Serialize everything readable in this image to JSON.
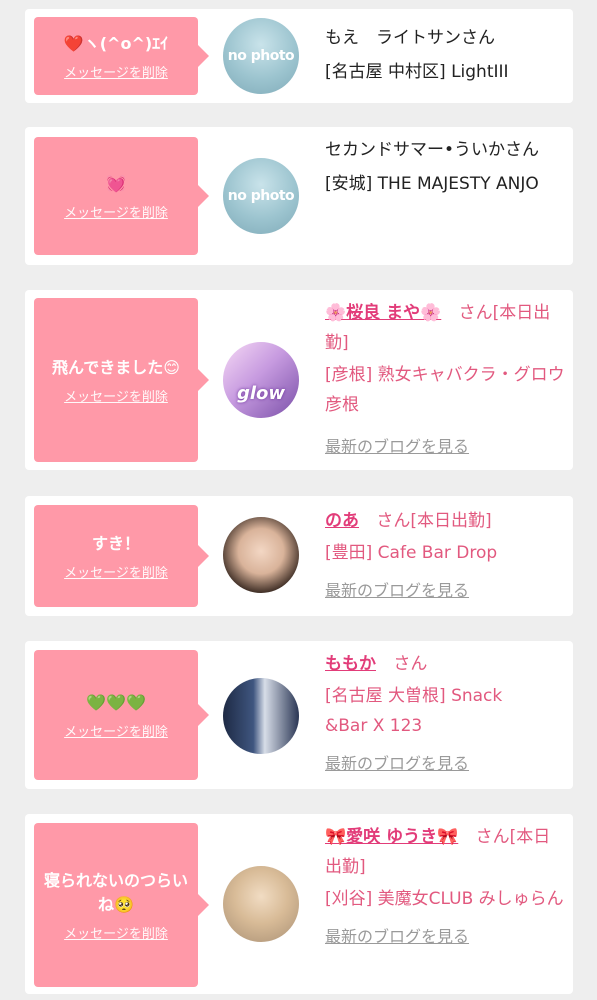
{
  "delete_label": "メッセージを削除",
  "blog_label": "最新のブログを見る",
  "san": "さん",
  "colors": {
    "bubble": "#ff99a8",
    "name_link": "#e23c79",
    "shop_pink": "#e2597f"
  },
  "cards": [
    {
      "message": "❤️ヽ(^o^)ｴｲ",
      "name": "もえ　ライトサンさん",
      "shop": "[名古屋 中村区] LightIII",
      "avatar_text": "no photo"
    },
    {
      "message": "💓",
      "name": "セカンドサマー•ういかさん",
      "shop": "[安城] THE MAJESTY ANJO",
      "avatar_text": "no photo"
    },
    {
      "message": "飛んできました😊",
      "name": "🌸桜良 まや🌸",
      "status": "[本日出勤]",
      "shop": "[彦根] 熟女キャバクラ・グロウ彦根",
      "avatar_text": "glow"
    },
    {
      "message": "すき！",
      "name": "のあ",
      "status": "[本日出勤]",
      "shop": "[豊田] Cafe Bar Drop"
    },
    {
      "message": "💚💚💚",
      "name": "ももか",
      "shop": "[名古屋 大曽根] Snack&Bar X 123"
    },
    {
      "message": "寝られないのつらいね🥺",
      "name": "🎀愛咲 ゆうき🎀",
      "status": "[本日出勤]",
      "shop": "[刈谷] 美魔女CLUB みしゅらん"
    }
  ]
}
